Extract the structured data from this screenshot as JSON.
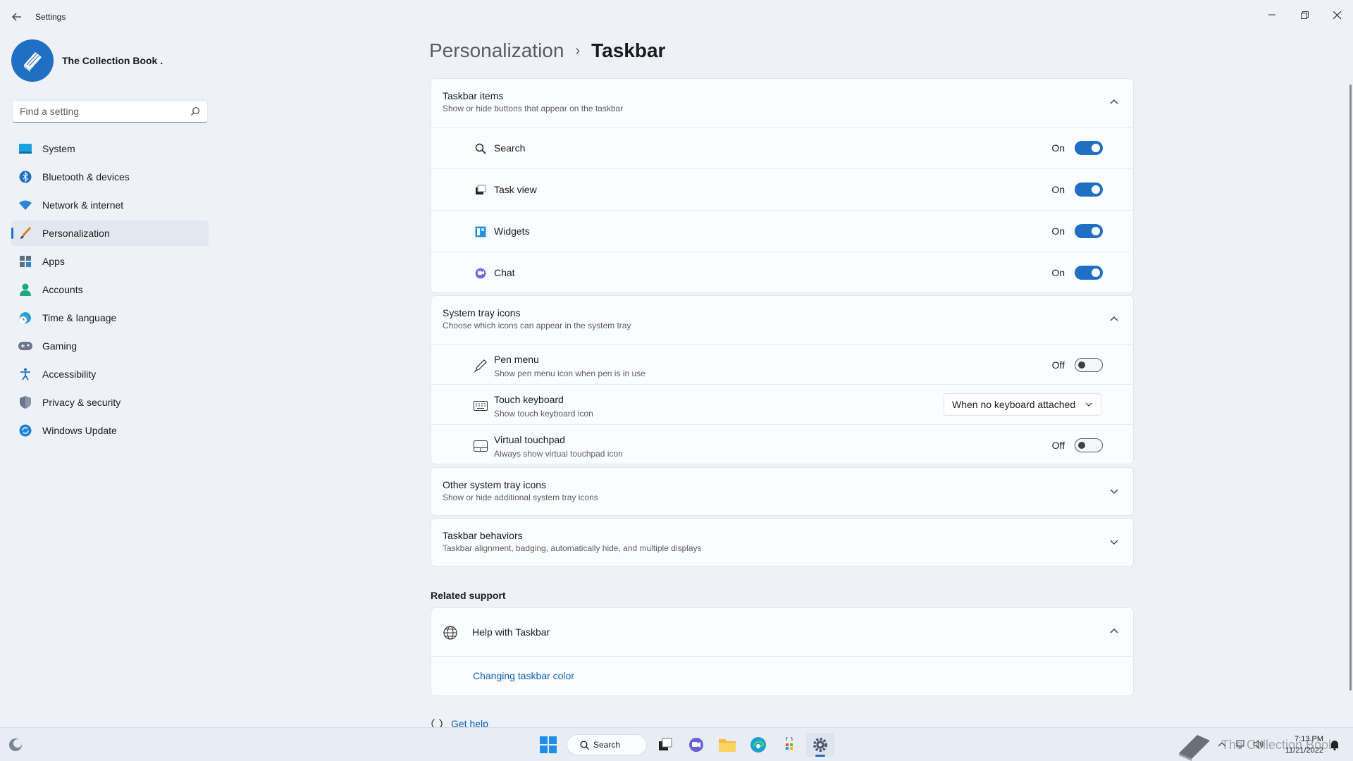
{
  "window": {
    "app_title": "Settings",
    "minimize": "─",
    "maximize": "❐",
    "close": "✕",
    "back": "←"
  },
  "profile": {
    "name": "The Collection Book ."
  },
  "search": {
    "placeholder": "Find a setting"
  },
  "sidebar": {
    "items": [
      {
        "label": "System",
        "icon": "system-icon"
      },
      {
        "label": "Bluetooth & devices",
        "icon": "bluetooth-icon"
      },
      {
        "label": "Network & internet",
        "icon": "wifi-icon"
      },
      {
        "label": "Personalization",
        "icon": "brush-icon",
        "active": true
      },
      {
        "label": "Apps",
        "icon": "apps-icon"
      },
      {
        "label": "Accounts",
        "icon": "account-icon"
      },
      {
        "label": "Time & language",
        "icon": "globe-clock-icon"
      },
      {
        "label": "Gaming",
        "icon": "gamepad-icon"
      },
      {
        "label": "Accessibility",
        "icon": "accessibility-icon"
      },
      {
        "label": "Privacy & security",
        "icon": "shield-icon"
      },
      {
        "label": "Windows Update",
        "icon": "update-icon"
      }
    ]
  },
  "breadcrumb": {
    "parent": "Personalization",
    "separator": "›",
    "current": "Taskbar"
  },
  "taskbar_items": {
    "title": "Taskbar items",
    "subtitle": "Show or hide buttons that appear on the taskbar",
    "rows": [
      {
        "label": "Search",
        "state": "On",
        "icon": "search-icon"
      },
      {
        "label": "Task view",
        "state": "On",
        "icon": "task-view-icon"
      },
      {
        "label": "Widgets",
        "state": "On",
        "icon": "widgets-icon"
      },
      {
        "label": "Chat",
        "state": "On",
        "icon": "chat-icon"
      }
    ]
  },
  "system_tray": {
    "title": "System tray icons",
    "subtitle": "Choose which icons can appear in the system tray",
    "pen": {
      "label": "Pen menu",
      "sub": "Show pen menu icon when pen is in use",
      "state": "Off"
    },
    "keyboard": {
      "label": "Touch keyboard",
      "sub": "Show touch keyboard icon",
      "value": "When no keyboard attached"
    },
    "touchpad": {
      "label": "Virtual touchpad",
      "sub": "Always show virtual touchpad icon",
      "state": "Off"
    }
  },
  "other_tray": {
    "title": "Other system tray icons",
    "subtitle": "Show or hide additional system tray icons"
  },
  "behaviors": {
    "title": "Taskbar behaviors",
    "subtitle": "Taskbar alignment, badging, automatically hide, and multiple displays"
  },
  "related": {
    "heading": "Related support",
    "help_title": "Help with Taskbar",
    "link": "Changing taskbar color",
    "get_help": "Get help"
  },
  "taskbar": {
    "search_label": "Search",
    "watermark": "The Collection Book",
    "time": "7:13 PM",
    "date": "11/21/2022"
  },
  "colors": {
    "accent": "#1f6fc5",
    "background": "#eef2f8",
    "card": "#fbfcfe"
  }
}
